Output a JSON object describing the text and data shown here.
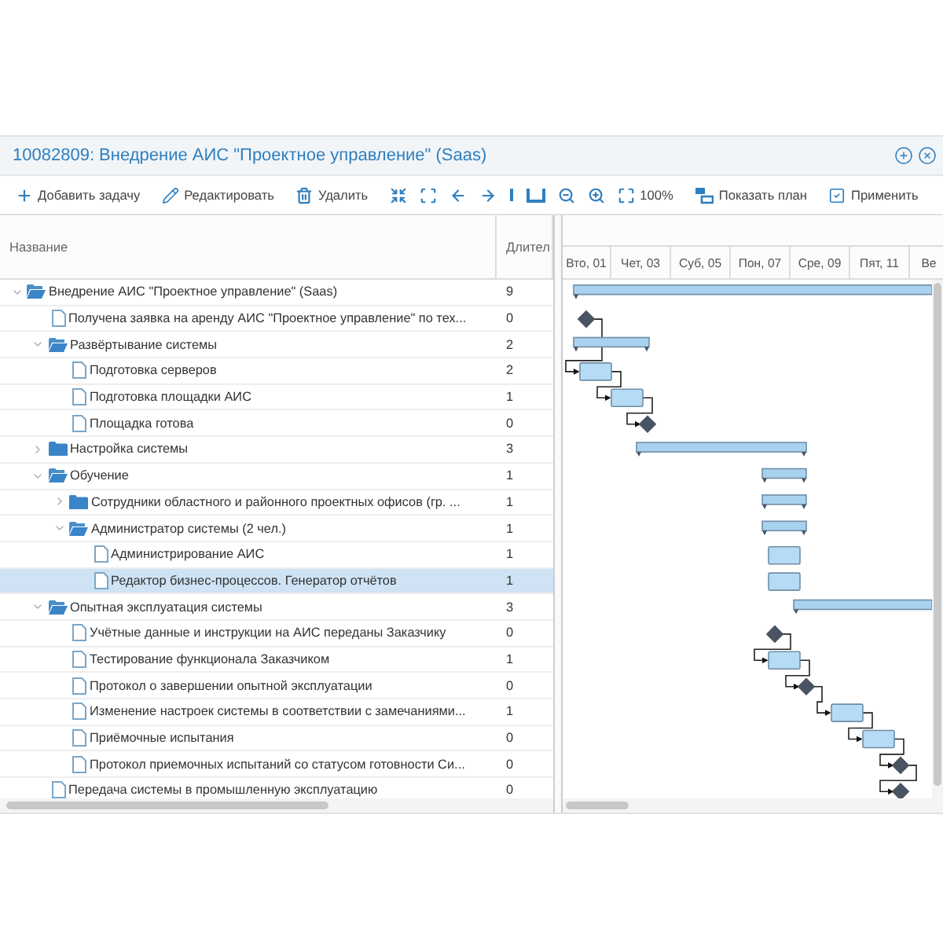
{
  "window": {
    "title": "10082809: Внедрение АИС \"Проектное управление\" (Saas)"
  },
  "toolbar": [
    {
      "kind": "add",
      "label": "Добавить задачу"
    },
    {
      "kind": "edit",
      "label": "Редактировать"
    },
    {
      "kind": "delete",
      "label": "Удалить"
    },
    {
      "kind": "collapse"
    },
    {
      "kind": "expand"
    },
    {
      "kind": "left"
    },
    {
      "kind": "right"
    },
    {
      "kind": "today"
    },
    {
      "kind": "range"
    },
    {
      "kind": "zoom-out"
    },
    {
      "kind": "zoom-in"
    },
    {
      "kind": "fit",
      "label": "100%"
    },
    {
      "kind": "plan",
      "label": "Показать план"
    },
    {
      "kind": "apply",
      "label": "Применить"
    }
  ],
  "grid": {
    "columns": [
      "Название",
      "Длител"
    ]
  },
  "timeline": {
    "columns": [
      "Вто, 01",
      "Чет, 03",
      "Суб, 05",
      "Пон, 07",
      "Сре, 09",
      "Пят, 11",
      "Ве"
    ]
  },
  "tasks": [
    {
      "name": "Внедрение АИС \"Проектное управление\" (Saas)",
      "duration": "9",
      "kind": "folder",
      "expanded": true,
      "selected": false,
      "bar": {
        "kind": "summary"
      },
      "children": [
        {
          "name": "Получена заявка на аренду АИС \"Проектное управление\" по тех...",
          "duration": "0",
          "kind": "file",
          "selected": false,
          "bar": {
            "kind": "milestone"
          }
        },
        {
          "name": "Развёртывание системы",
          "duration": "2",
          "kind": "folder",
          "expanded": true,
          "selected": false,
          "bar": {
            "kind": "summary"
          },
          "children": [
            {
              "name": "Подготовка серверов",
              "duration": "2",
              "kind": "file",
              "selected": false,
              "bar": {
                "kind": "task"
              }
            },
            {
              "name": "Подготовка площадки АИС",
              "duration": "1",
              "kind": "file",
              "selected": false,
              "bar": {
                "kind": "task"
              }
            },
            {
              "name": "Площадка готова",
              "duration": "0",
              "kind": "file",
              "selected": false,
              "bar": {
                "kind": "milestone"
              }
            }
          ]
        },
        {
          "name": "Настройка системы",
          "duration": "3",
          "kind": "folder",
          "expanded": false,
          "selected": false,
          "bar": {
            "kind": "summary"
          }
        },
        {
          "name": "Обучение",
          "duration": "1",
          "kind": "folder",
          "expanded": true,
          "selected": false,
          "bar": {
            "kind": "summary"
          },
          "children": [
            {
              "name": "Сотрудники областного и районного проектных офисов (гр. ...",
              "duration": "1",
              "kind": "folder",
              "expanded": false,
              "selected": false,
              "bar": {
                "kind": "summary"
              }
            },
            {
              "name": "Администратор системы (2 чел.)",
              "duration": "1",
              "kind": "folder",
              "expanded": true,
              "selected": false,
              "bar": {
                "kind": "summary"
              },
              "children": [
                {
                  "name": "Администрирование АИС",
                  "duration": "1",
                  "kind": "file",
                  "selected": false,
                  "bar": {
                    "kind": "task"
                  }
                },
                {
                  "name": "Редактор бизнес-процессов. Генератор отчётов",
                  "duration": "1",
                  "kind": "file",
                  "selected": true,
                  "bar": {
                    "kind": "task"
                  }
                }
              ]
            }
          ]
        },
        {
          "name": "Опытная эксплуатация системы",
          "duration": "3",
          "kind": "folder",
          "expanded": true,
          "selected": false,
          "bar": {
            "kind": "summary"
          },
          "children": [
            {
              "name": "Учётные данные и инструкции на АИС переданы Заказчику",
              "duration": "0",
              "kind": "file",
              "selected": false,
              "bar": {
                "kind": "milestone"
              }
            },
            {
              "name": "Тестирование функционала Заказчиком",
              "duration": "1",
              "kind": "file",
              "selected": false,
              "bar": {
                "kind": "task"
              }
            },
            {
              "name": "Протокол о завершении опытной эксплуатации",
              "duration": "0",
              "kind": "file",
              "selected": false,
              "bar": {
                "kind": "milestone"
              }
            },
            {
              "name": "Изменение настроек системы в соответствии с замечаниями...",
              "duration": "1",
              "kind": "file",
              "selected": false,
              "bar": {
                "kind": "task"
              }
            },
            {
              "name": "Приёмочные испытания",
              "duration": "0",
              "kind": "file",
              "selected": false,
              "bar": {
                "kind": "task"
              }
            },
            {
              "name": "Протокол приемочных испытаний со статусом готовности Си...",
              "duration": "0",
              "kind": "file",
              "selected": false,
              "bar": {
                "kind": "milestone"
              }
            }
          ]
        },
        {
          "name": "Передача системы в промышленную эксплуатацию",
          "duration": "0",
          "kind": "file",
          "selected": false,
          "bar": {
            "kind": "milestone"
          }
        }
      ]
    }
  ]
}
